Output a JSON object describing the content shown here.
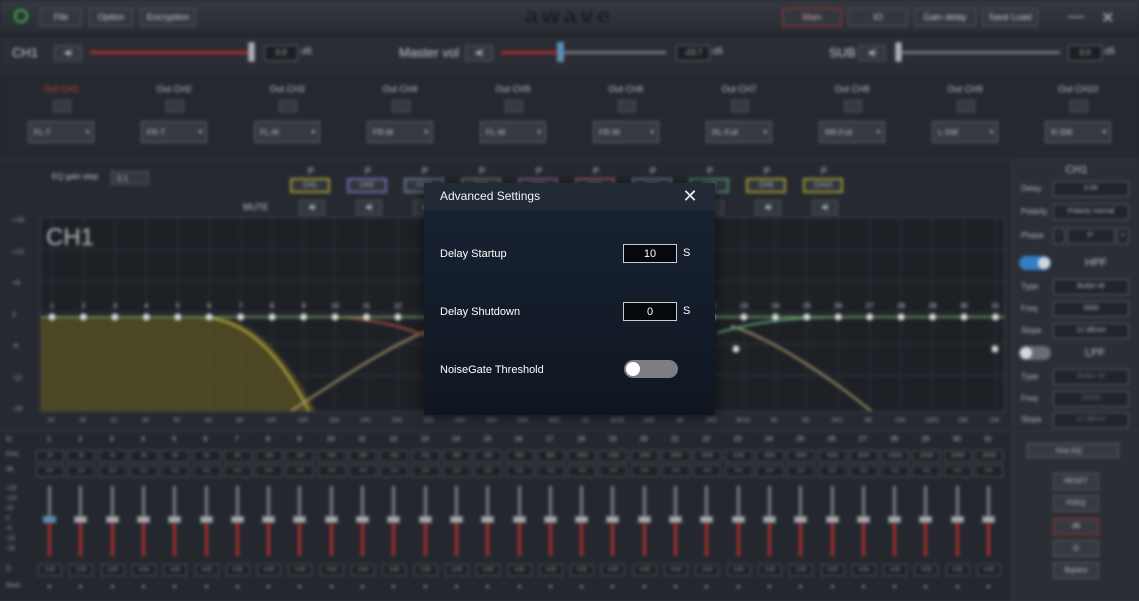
{
  "menu": {
    "file": "File",
    "option": "Option",
    "encryption": "Encryption",
    "main": "Main",
    "io": "IO",
    "gain_delay": "Gain delay",
    "save_load": "Save Load"
  },
  "logo": "awave",
  "window": {
    "minimize": "—",
    "close": "✕"
  },
  "volume": {
    "ch1_label": "CH1",
    "ch1_value": "0.0",
    "ch1_unit": "dB",
    "master_label": "Master vol",
    "master_value": "-23.7",
    "master_unit": "dB",
    "sub_label": "SUB",
    "sub_value": "0.0",
    "sub_unit": "dB",
    "speaker_glyph": "◀)"
  },
  "outputs": [
    {
      "label": "Out CH1",
      "assign": "FL-T"
    },
    {
      "label": "Out CH2",
      "assign": "FR-T"
    },
    {
      "label": "Out CH3",
      "assign": "FL-M"
    },
    {
      "label": "Out CH4",
      "assign": "FR-M"
    },
    {
      "label": "Out CH5",
      "assign": "FL-W"
    },
    {
      "label": "Out CH6",
      "assign": "FR-W"
    },
    {
      "label": "Out CH7",
      "assign": "RL-Full"
    },
    {
      "label": "Out CH8",
      "assign": "RR-Full"
    },
    {
      "label": "Out CH9",
      "assign": "L-SW"
    },
    {
      "label": "Out CH10",
      "assign": "R-SW"
    }
  ],
  "graph": {
    "eq_gain_step_label": "EQ gain step",
    "eq_gain_step_value": "0.1",
    "mute_label": "MUTE",
    "title": "CH1",
    "channel_buttons": [
      {
        "p": "P",
        "label": "CH1",
        "color": "#b5a93a"
      },
      {
        "p": "P",
        "label": "CH2",
        "color": "#8a74c8"
      },
      {
        "p": "P",
        "label": "CH3",
        "color": "#6f8da6"
      },
      {
        "p": "P",
        "label": "CH4",
        "color": "#7f868e"
      },
      {
        "p": "P",
        "label": "CH5",
        "color": "#a26bb8"
      },
      {
        "p": "P",
        "label": "CH6",
        "color": "#b86b6b"
      },
      {
        "p": "P",
        "label": "CH7",
        "color": "#6f8da6"
      },
      {
        "p": "P",
        "label": "CH8",
        "color": "#5a9c79"
      },
      {
        "p": "P",
        "label": "CH9",
        "color": "#b5a93a"
      },
      {
        "p": "P",
        "label": "CH10",
        "color": "#b5a93a"
      }
    ],
    "y_labels": [
      "+18",
      "+12",
      "+6",
      "0",
      "-6",
      "-12",
      "-18"
    ],
    "x_labels": [
      "20",
      "25",
      "32",
      "40",
      "50",
      "63",
      "80",
      "100",
      "125",
      "160",
      "200",
      "250",
      "315",
      "400",
      "500",
      "630",
      "800",
      "1K",
      "1K25",
      "1K6",
      "2K",
      "2K5",
      "3K15",
      "4K",
      "5K",
      "6K3",
      "8K",
      "10K",
      "12K5",
      "16K",
      "20K"
    ],
    "band_points": [
      "1",
      "2",
      "3",
      "4",
      "5",
      "6",
      "7",
      "8",
      "9",
      "10",
      "11",
      "12",
      "13",
      "14",
      "15",
      "16",
      "17",
      "18",
      "19",
      "20",
      "21",
      "22",
      "23",
      "24",
      "25",
      "26",
      "27",
      "28",
      "29",
      "30",
      "31"
    ]
  },
  "right_panel": {
    "title": "CH1",
    "delay_label": "Delay",
    "delay_value": "0.00",
    "polarity_label": "Polarity",
    "polarity_value": "Polarity normal",
    "phase_label": "Phase",
    "phase_value": "0°",
    "phase_minus": "-",
    "phase_plus": "+",
    "hpf_label": "HPF",
    "hpf_type_label": "Type",
    "hpf_type": "Butter-W",
    "hpf_freq_label": "Freq",
    "hpf_freq": "3000",
    "hpf_slope_label": "Slope",
    "hpf_slope": "12 dB/oct",
    "lpf_label": "LPF",
    "lpf_type_label": "Type",
    "lpf_type": "Butter-W",
    "lpf_freq_label": "Freq",
    "lpf_freq": "20000",
    "lpf_slope_label": "Slope",
    "lpf_slope": "12 dB/oct"
  },
  "bands": {
    "id_label": "ID",
    "freq_label": "F/Hz",
    "gain_label": "dB",
    "q_label": "Q",
    "mask_label": "Mask",
    "scale": [
      "+15",
      "+10",
      "+5",
      "0",
      "-5",
      "-10",
      "-15"
    ],
    "freqs": [
      "20",
      "25",
      "31",
      "40",
      "50",
      "63",
      "80",
      "100",
      "125",
      "160",
      "200",
      "250",
      "315",
      "400",
      "500",
      "630",
      "800",
      "1000",
      "1250",
      "1600",
      "2000",
      "2500",
      "3150",
      "4000",
      "5000",
      "6300",
      "8000",
      "10000",
      "12500",
      "16000",
      "20000"
    ],
    "gain_value": "0.0",
    "q_value": "4.00"
  },
  "eq_buttons": {
    "mode": "Fine EQ",
    "reset": "RESET",
    "freq": "FREQ",
    "db": "dB",
    "q": "Q",
    "bypass": "Bypass"
  },
  "dialog": {
    "title": "Advanced Settings",
    "close": "✕",
    "delay_startup_label": "Delay Startup",
    "delay_startup_value": "10",
    "delay_startup_unit": "S",
    "delay_shutdown_label": "Delay Shutdown",
    "delay_shutdown_value": "0",
    "delay_shutdown_unit": "S",
    "noisegate_label": "NoiseGate Threshold",
    "noisegate_on": false
  }
}
